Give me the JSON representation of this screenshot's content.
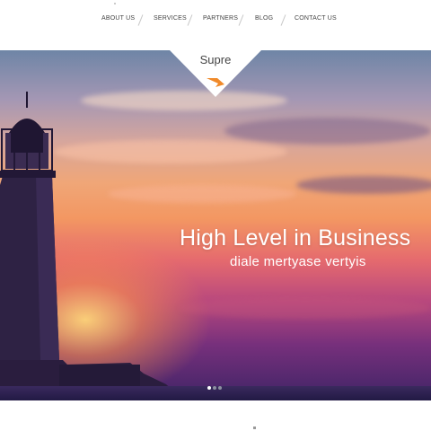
{
  "nav": {
    "items": [
      {
        "label": "ABOUT US"
      },
      {
        "label": "SERVICES"
      },
      {
        "label": "PARTNERS"
      },
      {
        "label": "BLOG"
      },
      {
        "label": "CONTACT US"
      }
    ]
  },
  "logo": {
    "text": "Supre",
    "accent_color": "#f08a2a"
  },
  "hero": {
    "title": "High Level in Business",
    "subtitle": "diale mertyase vertyis",
    "slides": {
      "count": 3,
      "active_index": 1
    }
  },
  "colors": {
    "nav_text": "#444444",
    "hero_text": "#ffffff",
    "background": "#ffffff"
  },
  "icons": [
    "lighthouse-image",
    "logo-arrow-icon"
  ]
}
